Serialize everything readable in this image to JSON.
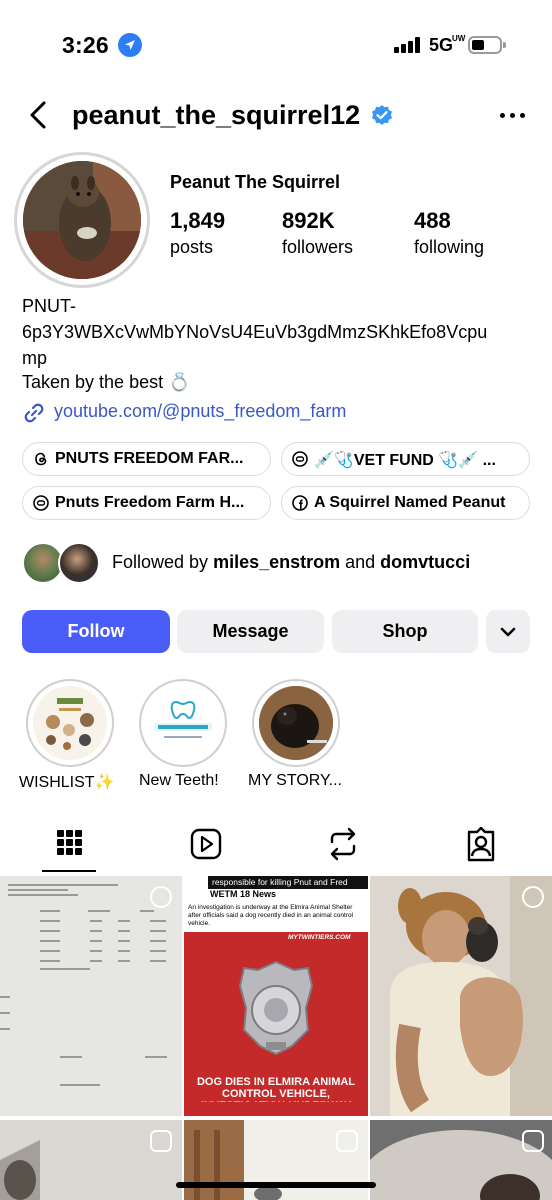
{
  "status": {
    "time": "3:26",
    "network": "5G",
    "network_sup": "UW"
  },
  "header": {
    "username": "peanut_the_squirrel12"
  },
  "profile": {
    "display_name": "Peanut The Squirrel",
    "stats": [
      {
        "value": "1,849",
        "label": "posts"
      },
      {
        "value": "892K",
        "label": "followers"
      },
      {
        "value": "488",
        "label": "following"
      }
    ],
    "bio_lines": [
      "PNUT-",
      "6p3Y3WBXcVwMbYNoVsU4EuVb3gdMmzSKhkEfo8Vcpu",
      "mp",
      "Taken by the best 💍"
    ],
    "link": "youtube.com/@pnuts_freedom_farm"
  },
  "pills": [
    {
      "label": "PNUTS FREEDOM FAR...",
      "icon": "threads-icon"
    },
    {
      "label": "💉🩺VET FUND 🩺💉 ...",
      "icon": "link-circle-icon"
    },
    {
      "label": "Pnuts Freedom Farm H...",
      "icon": "link-circle-icon"
    },
    {
      "label": "A Squirrel Named Peanut",
      "icon": "facebook-icon"
    }
  ],
  "followed_by": {
    "prefix": "Followed by ",
    "user1": "miles_enstrom",
    "joiner": " and ",
    "user2": "domvtucci"
  },
  "actions": {
    "follow": "Follow",
    "message": "Message",
    "shop": "Shop"
  },
  "highlights": [
    {
      "label": "WISHLIST✨"
    },
    {
      "label": "New Teeth!"
    },
    {
      "label": "MY STORY..."
    }
  ],
  "tabs": [
    "grid-icon",
    "reels-icon",
    "reposts-icon",
    "tagged-icon"
  ],
  "grid": {
    "post2_caption": "responsible for killing Pnut and Fred",
    "post2_source": "WETM 18 News",
    "post2_blurb": "An investigation is underway at the Elmira Animal Shelter after officials said a dog recently died in an animal control vehicle.",
    "post2_site": "MYTWINTIERS.COM",
    "post2_headline": "DOG DIES IN ELMIRA ANIMAL CONTROL VEHICLE, INVESTIGATION UNDERWAY"
  },
  "colors": {
    "accent": "#4a5df9",
    "link": "#3a57c7",
    "verified": "#3897f0",
    "secondary_btn": "#efeff1"
  }
}
